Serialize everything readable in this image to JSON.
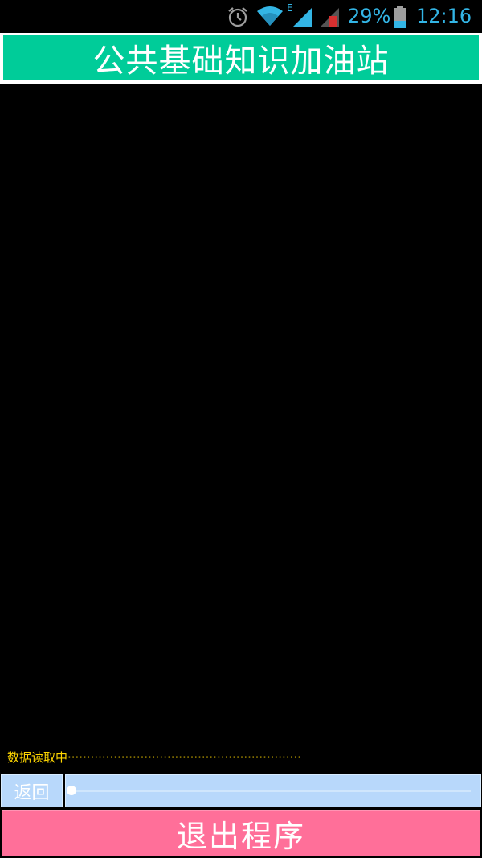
{
  "status_bar": {
    "battery_percent": "29%",
    "time": "12:16",
    "network_type": "E",
    "icons": [
      "alarm-icon",
      "wifi-icon",
      "signal-icon",
      "signal-weak-icon",
      "battery-icon"
    ]
  },
  "header": {
    "title": "公共基础知识加油站"
  },
  "content": {
    "loading_text": "数据读取中·····························································"
  },
  "controls": {
    "back_label": "返回",
    "progress": 0.0
  },
  "footer": {
    "exit_label": "退出程序"
  },
  "colors": {
    "title_bg": "#00cc99",
    "exit_bg": "#ff6f99",
    "control_bg": "#b8d8fb",
    "status_accent": "#33b5e5",
    "loading_text": "#ffd700"
  }
}
